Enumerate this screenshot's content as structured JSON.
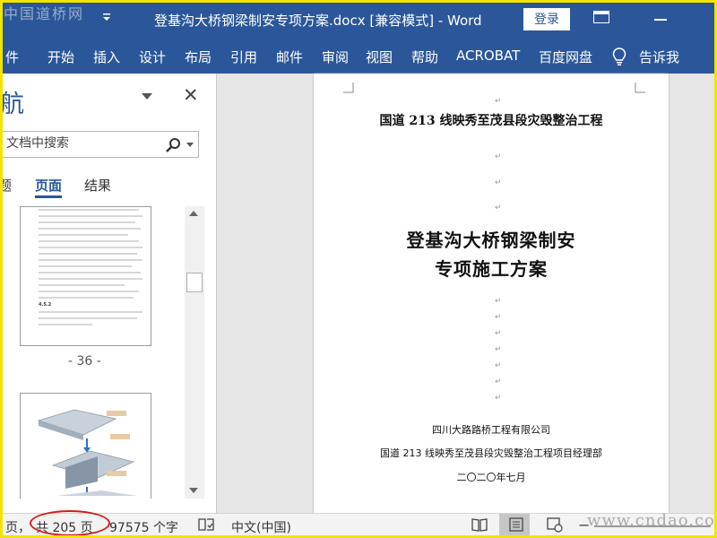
{
  "colors": {
    "ribbon_blue": "#2b579a",
    "frame_yellow": "#f3e400",
    "annotation_red": "#d91b1b"
  },
  "titlebar": {
    "watermark": "中国道桥网",
    "qat_icon": "customize-quick-access-chevron-icon",
    "document_title": "登基沟大桥钢梁制安专项方案.docx [兼容模式]  -  Word",
    "login_label": "登录",
    "ribbon_display_icon": "ribbon-display-options-icon",
    "minimize_icon": "minimize-icon"
  },
  "ribbon": {
    "tabs": [
      "件",
      "开始",
      "插入",
      "设计",
      "布局",
      "引用",
      "邮件",
      "审阅",
      "视图",
      "帮助",
      "ACROBAT",
      "百度网盘"
    ],
    "tell_me_icon": "lightbulb-icon",
    "tell_me_label": "告诉我"
  },
  "nav_pane": {
    "title": "航",
    "dropdown_icon": "pane-options-dropdown-icon",
    "close_icon": "close-icon",
    "search_placeholder": "文档中搜索",
    "search_icon": "search-icon",
    "tabs": [
      "题",
      "页面",
      "结果"
    ],
    "active_tab": "页面",
    "thumbnails": [
      {
        "page_label": "- 36 -",
        "mini_heading": "4.5.2"
      },
      {
        "page_label": ""
      }
    ],
    "scrollbar": {
      "up_icon": "scroll-up-arrow-icon",
      "down_icon": "scroll-down-arrow-icon"
    }
  },
  "document": {
    "paragraph_mark": "↵",
    "project_name": "国道 213 线映秀至茂县段灾毁整治工程",
    "title_line1": "登基沟大桥钢梁制安",
    "title_line2": "专项施工方案",
    "company": "四川大路路桥工程有限公司",
    "department": "国道 213 线映秀至茂县段灾毁整治工程项目经理部",
    "date": "二〇二〇年七月"
  },
  "statusbar": {
    "page_prefix": "页，",
    "page_count": "共 205 页",
    "word_count": "97575 个字",
    "proofing_icon": "proofing-book-icon",
    "language": "中文(中国)",
    "view_icons": [
      "read-mode-icon",
      "print-layout-icon",
      "web-layout-icon"
    ],
    "active_view": "print-layout-icon",
    "zoom_minus": "−",
    "watermark": "www.cndao.com"
  }
}
